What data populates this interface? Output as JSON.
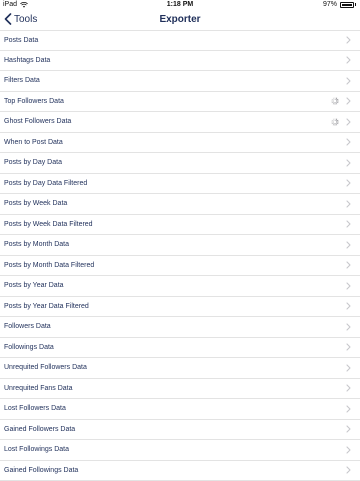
{
  "status_bar": {
    "carrier": "iPad",
    "time": "1:18 PM",
    "battery": "97%"
  },
  "nav": {
    "back_label": "Tools",
    "title": "Exporter"
  },
  "items": [
    {
      "label": "Posts Data",
      "loading": false
    },
    {
      "label": "Hashtags Data",
      "loading": false
    },
    {
      "label": "Filters Data",
      "loading": false
    },
    {
      "label": "Top Followers Data",
      "loading": true
    },
    {
      "label": "Ghost Followers Data",
      "loading": true
    },
    {
      "label": "When to Post Data",
      "loading": false
    },
    {
      "label": "Posts by Day Data",
      "loading": false
    },
    {
      "label": "Posts by Day Data Filtered",
      "loading": false
    },
    {
      "label": "Posts by Week Data",
      "loading": false
    },
    {
      "label": "Posts by Week Data Filtered",
      "loading": false
    },
    {
      "label": "Posts by Month Data",
      "loading": false
    },
    {
      "label": "Posts by Month Data Filtered",
      "loading": false
    },
    {
      "label": "Posts by Year Data",
      "loading": false
    },
    {
      "label": "Posts by Year Data Filtered",
      "loading": false
    },
    {
      "label": "Followers Data",
      "loading": false
    },
    {
      "label": "Followings Data",
      "loading": false
    },
    {
      "label": "Unrequited Followers Data",
      "loading": false
    },
    {
      "label": "Unrequited Fans Data",
      "loading": false
    },
    {
      "label": "Lost Followers Data",
      "loading": false
    },
    {
      "label": "Gained Followers Data",
      "loading": false
    },
    {
      "label": "Lost Followings Data",
      "loading": false
    },
    {
      "label": "Gained Followings Data",
      "loading": false
    }
  ],
  "colors": {
    "text": "#1f2f5a",
    "chevron": "#c7c7cc",
    "separator": "#e3e3e3"
  },
  "icons": {
    "back": "chevron-left-icon",
    "row": "chevron-right-icon",
    "loading": "spinner-icon",
    "wifi": "wifi-icon",
    "battery": "battery-icon"
  }
}
